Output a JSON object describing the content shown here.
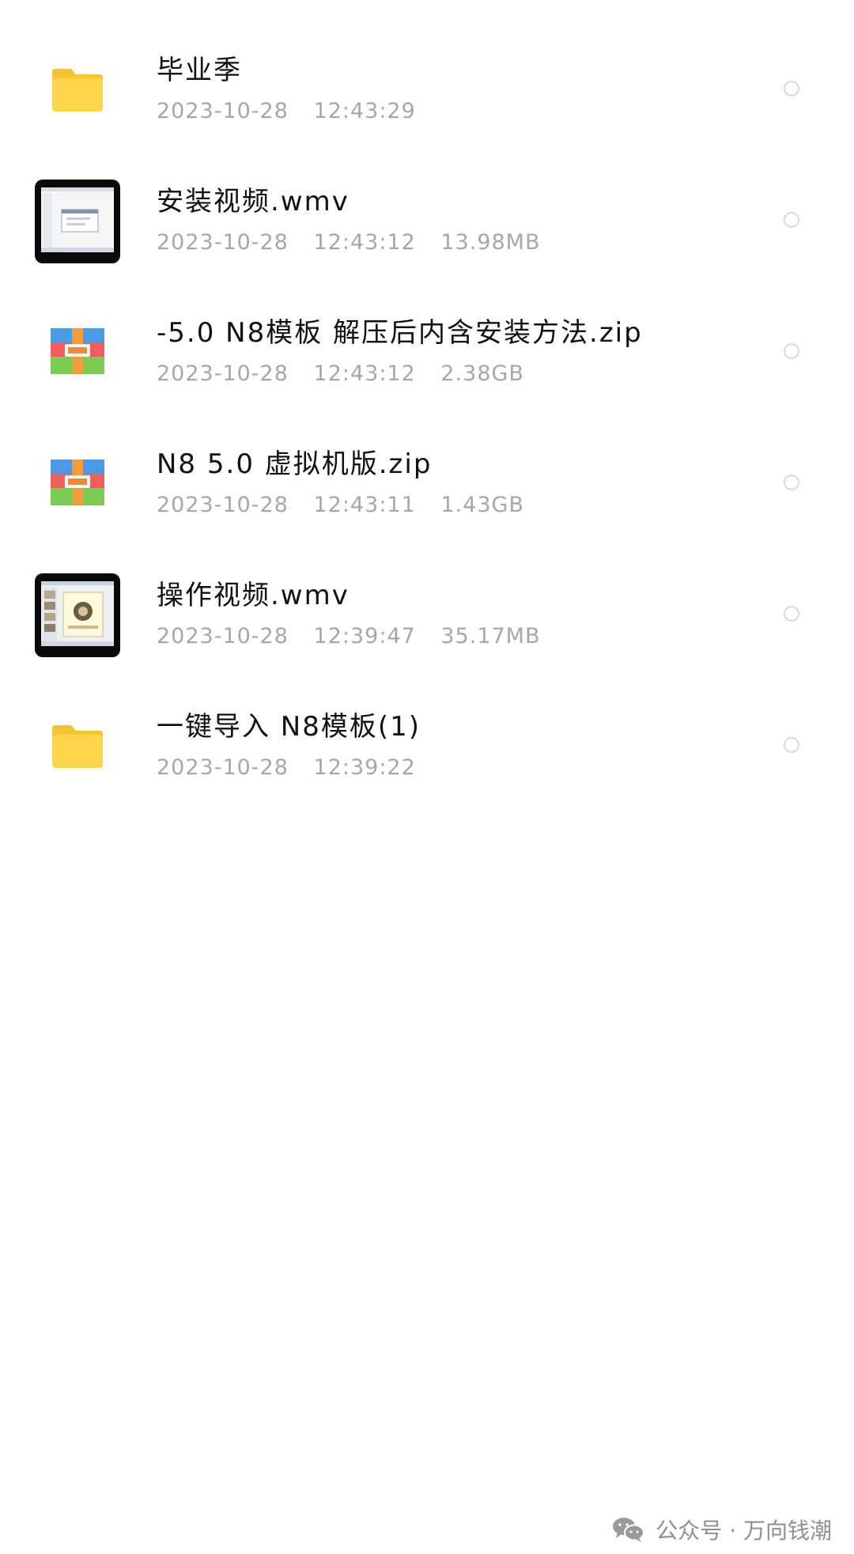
{
  "files": [
    {
      "name": "毕业季",
      "date": "2023-10-28",
      "time": "12:43:29",
      "size": "",
      "icon": "folder-icon"
    },
    {
      "name": "安装视频.wmv",
      "date": "2023-10-28",
      "time": "12:43:12",
      "size": "13.98MB",
      "icon": "video-thumbnail-icon"
    },
    {
      "name": "-5.0 N8模板  解压后内含安装方法.zip",
      "date": "2023-10-28",
      "time": "12:43:12",
      "size": "2.38GB",
      "icon": "zip-archive-icon"
    },
    {
      "name": "N8 5.0 虚拟机版.zip",
      "date": "2023-10-28",
      "time": "12:43:11",
      "size": "1.43GB",
      "icon": "zip-archive-icon"
    },
    {
      "name": "操作视频.wmv",
      "date": "2023-10-28",
      "time": "12:39:47",
      "size": "35.17MB",
      "icon": "video-thumbnail-icon"
    },
    {
      "name": "一键导入  N8模板(1)",
      "date": "2023-10-28",
      "time": "12:39:22",
      "size": "",
      "icon": "folder-icon"
    }
  ],
  "watermark": {
    "text": "公众号 · 万向钱潮",
    "icon": "wechat-icon"
  },
  "colors": {
    "folder": "#fdd64c",
    "meta_text": "#a7a7a7",
    "name_text": "#111111",
    "circle": "#d9d9d9"
  }
}
